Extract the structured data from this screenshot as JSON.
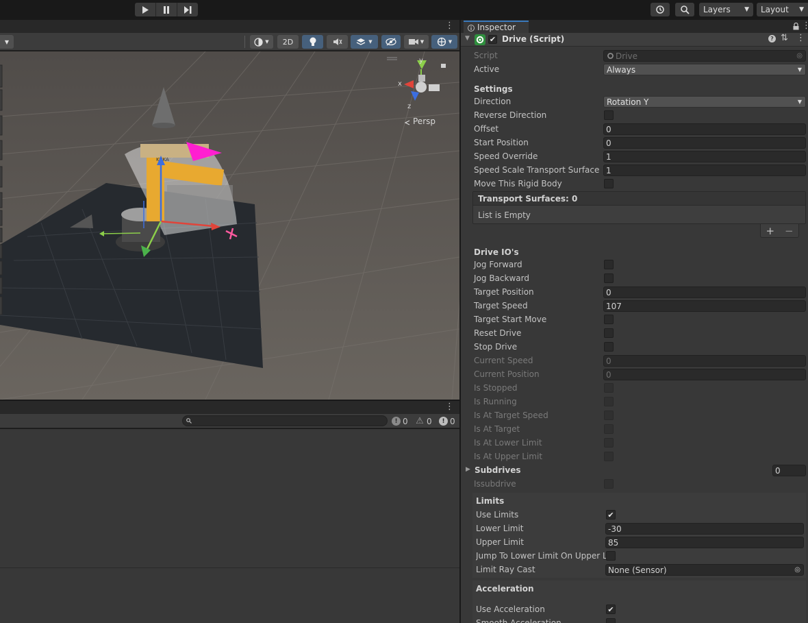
{
  "toolbar": {
    "play_icon": "play-icon",
    "pause_icon": "pause-icon",
    "step_icon": "step-icon",
    "history_icon": "history-icon",
    "search_icon": "search-icon",
    "layers_label": "Layers",
    "layout_label": "Layout"
  },
  "scene": {
    "view_2d_label": "2D",
    "gizmo_axis_x": "x",
    "gizmo_axis_y": "y",
    "gizmo_axis_z": "z",
    "projection_label": "Persp",
    "robot_decal_text": "KUKA"
  },
  "console": {
    "search_value": "",
    "log_count": "0",
    "warning_count": "0",
    "error_count": "0"
  },
  "inspector": {
    "tab_label": "Inspector",
    "component_title": "Drive (Script)",
    "component_enabled": true,
    "script_label": "Script",
    "script_value": "Drive",
    "active_label": "Active",
    "active_value": "Always",
    "settings_header": "Settings",
    "direction_label": "Direction",
    "direction_value": "Rotation Y",
    "reverse_direction_label": "Reverse Direction",
    "offset_label": "Offset",
    "offset_value": "0",
    "start_position_label": "Start Position",
    "start_position_value": "0",
    "speed_override_label": "Speed Override",
    "speed_override_value": "1",
    "speed_scale_label": "Speed Scale Transport Surface",
    "speed_scale_value": "1",
    "move_rigidbody_label": "Move This Rigid Body",
    "transport_surfaces_header": "Transport Surfaces: 0",
    "list_empty_text": "List is Empty",
    "list_add": "+",
    "list_remove": "−",
    "drive_ios_header": "Drive IO's",
    "jog_forward_label": "Jog Forward",
    "jog_backward_label": "Jog Backward",
    "target_position_label": "Target Position",
    "target_position_value": "0",
    "target_speed_label": "Target Speed",
    "target_speed_value": "107",
    "target_start_move_label": "Target Start Move",
    "reset_drive_label": "Reset Drive",
    "stop_drive_label": "Stop Drive",
    "current_speed_label": "Current Speed",
    "current_speed_value": "0",
    "current_position_label": "Current Position",
    "current_position_value": "0",
    "is_stopped_label": "Is Stopped",
    "is_running_label": "Is Running",
    "is_at_target_speed_label": "Is At Target Speed",
    "is_at_target_label": "Is At Target",
    "is_at_lower_limit_label": "Is At Lower Limit",
    "is_at_upper_limit_label": "Is At Upper Limit",
    "subdrives_label": "Subdrives",
    "subdrives_value": "0",
    "issubdrive_label": "Issubdrive",
    "limits_header": "Limits",
    "use_limits_label": "Use Limits",
    "use_limits_checked": true,
    "lower_limit_label": "Lower Limit",
    "lower_limit_value": "-30",
    "upper_limit_label": "Upper Limit",
    "upper_limit_value": "85",
    "jump_to_lower_label": "Jump To Lower Limit On Upper Li",
    "limit_raycast_label": "Limit Ray Cast",
    "limit_raycast_value": "None (Sensor)",
    "acceleration_header": "Acceleration",
    "use_acceleration_label": "Use Acceleration",
    "use_acceleration_checked": true,
    "smooth_acceleration_label": "Smooth Acceleration"
  },
  "colors": {
    "accent_blue": "#3a79bb",
    "panel_bg": "#383838",
    "field_bg": "#2a2a2a",
    "gizmo_x": "#e0443a",
    "gizmo_y": "#8ccf4a",
    "gizmo_z": "#3c6ee0",
    "gizmo_magenta": "#ff1fd0"
  }
}
